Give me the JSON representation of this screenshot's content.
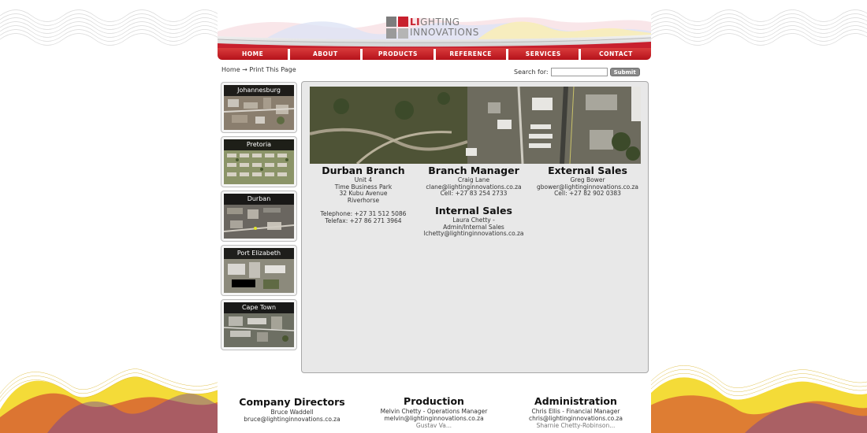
{
  "header": {
    "logo_line1_accent": "LI",
    "logo_line1_rest": "GHTING",
    "logo_line2": "INNOVATIONS"
  },
  "nav": [
    {
      "label": "HOME"
    },
    {
      "label": "ABOUT"
    },
    {
      "label": "PRODUCTS"
    },
    {
      "label": "REFERENCE"
    },
    {
      "label": "SERVICES"
    },
    {
      "label": "CONTACT"
    }
  ],
  "breadcrumb": {
    "home": "Home",
    "arrow": "→",
    "current": "Print This Page"
  },
  "search": {
    "label": "Search for:",
    "value": "",
    "button": "Submit"
  },
  "sidebar": [
    {
      "label": "Johannesburg"
    },
    {
      "label": "Pretoria"
    },
    {
      "label": "Durban"
    },
    {
      "label": "Port Elizabeth"
    },
    {
      "label": "Cape Town"
    }
  ],
  "branch": {
    "title": "Durban Branch",
    "line1": "Unit 4",
    "line2": "Time Business Park",
    "line3": "32 Kubu Avenue",
    "line4": "Riverhorse",
    "telephone": "Telephone: +27 31 512 5086",
    "telefax": "Telefax: +27 86 271 3964"
  },
  "manager": {
    "title": "Branch Manager",
    "name": "Craig Lane",
    "email": "clane@lightinginnovations.co.za",
    "cell": "Cell: +27 83 254 2733"
  },
  "external": {
    "title": "External Sales",
    "name": "Greg Bower",
    "email": "gbower@lightinginnovations.co.za",
    "cell": "Cell: +27 82 902 0383"
  },
  "internal": {
    "title": "Internal Sales",
    "name": "Laura Chetty -",
    "role": "Admin/Internal Sales",
    "email": "lchetty@lightinginnovations.co.za"
  },
  "footer": {
    "directors": {
      "title": "Company Directors",
      "name": "Bruce Waddell",
      "email": "bruce@lightinginnovations.co.za"
    },
    "production": {
      "title": "Production",
      "name": "Melvin Chetty - Operations Manager",
      "email": "melvin@lightinginnovations.co.za",
      "more": "Gustav Va..."
    },
    "administration": {
      "title": "Administration",
      "name": "Chris Ellis - Financial Manager",
      "email": "chris@lightinginnovations.co.za",
      "more": "Sharnie Chetty-Robinson..."
    }
  },
  "colors": {
    "nav_red": "#c8202d",
    "panel_bg": "#e8e8e8",
    "logo_grey": "#7a7a7a"
  }
}
